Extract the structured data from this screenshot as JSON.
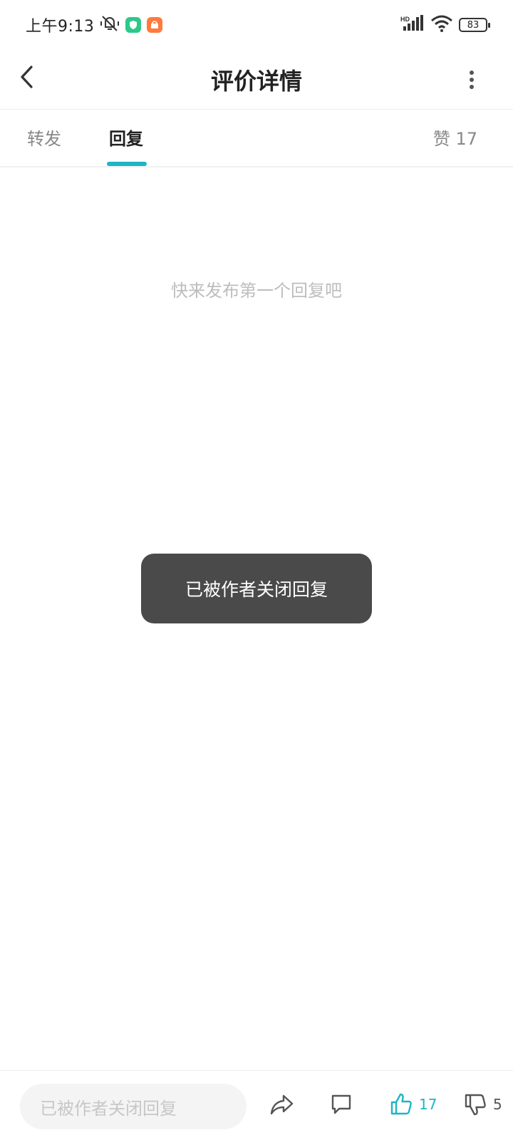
{
  "status_bar": {
    "time": "上午9:13",
    "battery": "83",
    "network": "HD"
  },
  "nav": {
    "title": "评价详情"
  },
  "tabs": [
    {
      "label": "转发",
      "active": false
    },
    {
      "label": "回复",
      "active": true
    }
  ],
  "likes": {
    "label": "赞 17"
  },
  "empty": {
    "hint": "快来发布第一个回复吧"
  },
  "toast": {
    "message": "已被作者关闭回复"
  },
  "bottom_bar": {
    "input_placeholder": "已被作者关闭回复",
    "like_count": "17",
    "dislike_count": "5"
  },
  "colors": {
    "accent": "#1cb6c5",
    "toast_bg": "#4a4a4a"
  }
}
